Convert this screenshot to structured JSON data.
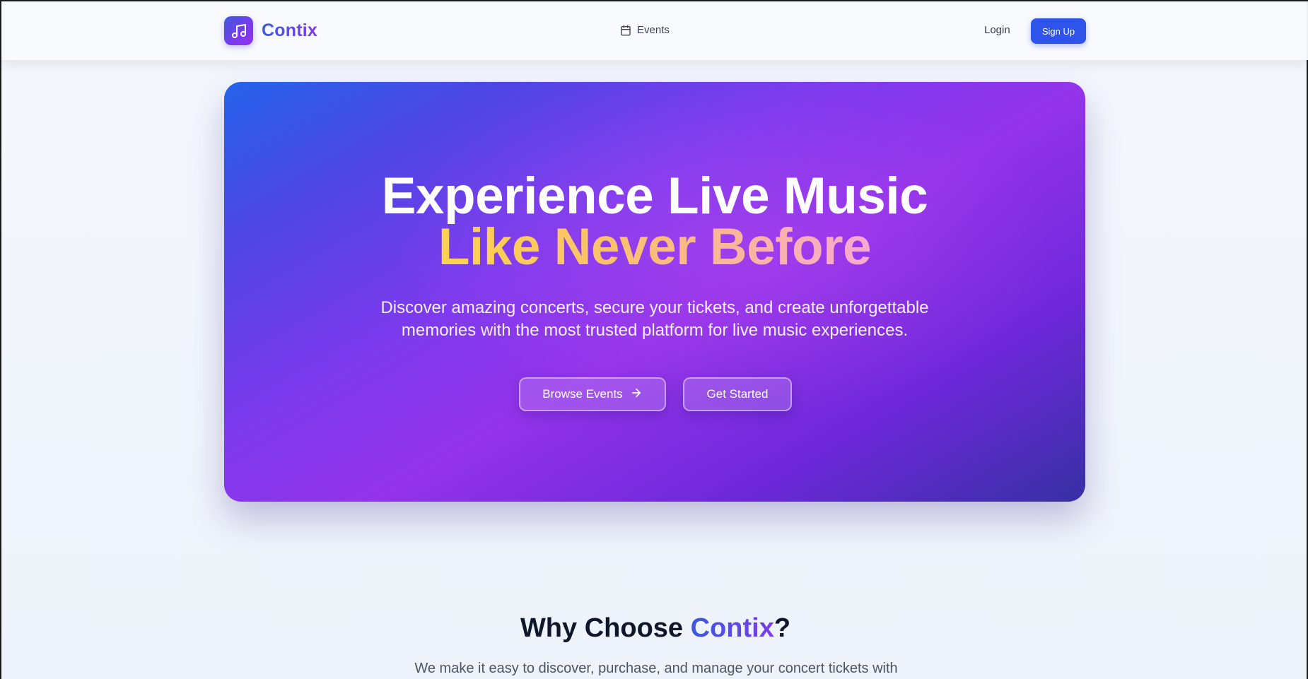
{
  "header": {
    "brand_name": "Contix",
    "brand_icon": "music-note-icon",
    "nav": {
      "events_label": "Events",
      "events_icon": "calendar-icon"
    },
    "login_label": "Login",
    "signup_label": "Sign Up"
  },
  "hero": {
    "title_line1": "Experience Live Music",
    "title_line2": "Like Never Before",
    "subtitle": "Discover amazing concerts, secure your tickets, and create unforgettable memories with the most trusted platform for live music experiences.",
    "browse_label": "Browse Events",
    "browse_icon": "arrow-right-icon",
    "start_label": "Get Started"
  },
  "why": {
    "title_prefix": "Why Choose ",
    "title_brand": "Contix",
    "title_suffix": "?",
    "text": "We make it easy to discover, purchase, and manage your concert tickets with"
  },
  "colors": {
    "accent_blue": "#2f54eb",
    "brand_gradient_start": "#3b5bdb",
    "brand_gradient_end": "#7c3aed",
    "hero_gradient_start": "#2563eb",
    "hero_gradient_mid": "#9333ea",
    "hero_gradient_end": "#3730a3",
    "title_accent_start": "#fcd34d",
    "title_accent_end": "#f9a8d4"
  }
}
